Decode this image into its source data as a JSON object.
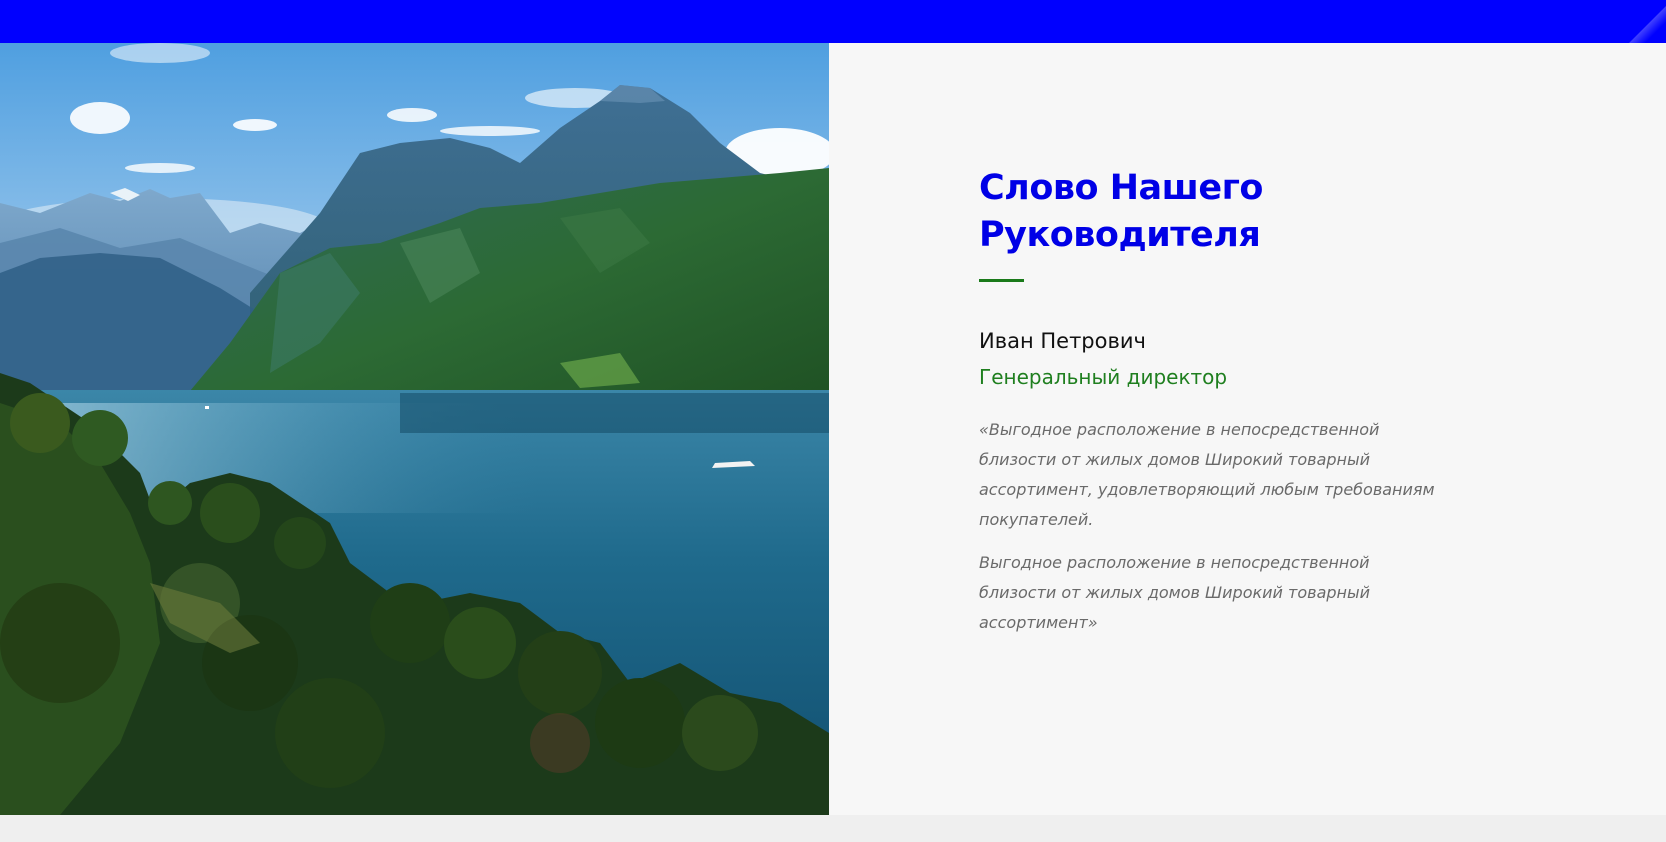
{
  "colors": {
    "topbar": "#0000ff",
    "heading": "#0000e6",
    "accent_green": "#1f7f1f",
    "quote_text": "#6a6a6a",
    "panel_bg": "#f7f7f7"
  },
  "hero_image": {
    "subject": "mountain lake landscape"
  },
  "leader": {
    "heading_line1": "Слово Нашего",
    "heading_line2": "Руководителя",
    "name": "Иван Петрович",
    "role": "Генеральный директор",
    "quote_paragraph1": "«Выгодное расположение в непосредственной близости от жилых домов Широкий товарный ассортимент, удовлетворяющий любым требованиям покупателей.",
    "quote_paragraph2": "Выгодное расположение в непосредственной близости от жилых домов Широкий товарный ассортимент»"
  }
}
